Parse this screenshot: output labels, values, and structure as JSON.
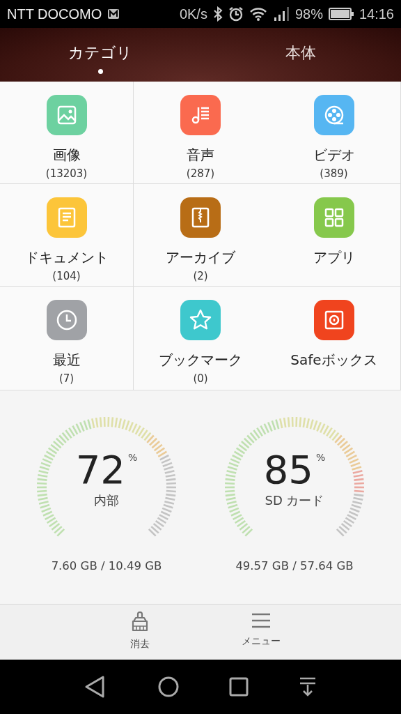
{
  "status_bar": {
    "carrier": "NTT DOCOMO",
    "speed": "0K/s",
    "battery": "98%",
    "time": "14:16"
  },
  "tabs": [
    {
      "label": "カテゴリ",
      "selected": true
    },
    {
      "label": "本体",
      "selected": false
    }
  ],
  "categories": [
    {
      "kind": "image",
      "label": "画像",
      "count": "(13203)",
      "color": "#6dd1a0"
    },
    {
      "kind": "audio",
      "label": "音声",
      "count": "(287)",
      "color": "#fa6a4f"
    },
    {
      "kind": "video",
      "label": "ビデオ",
      "count": "(389)",
      "color": "#56b6f2"
    },
    {
      "kind": "document",
      "label": "ドキュメント",
      "count": "(104)",
      "color": "#fcc53a"
    },
    {
      "kind": "archive",
      "label": "アーカイブ",
      "count": "(2)",
      "color": "#b86d16"
    },
    {
      "kind": "apps",
      "label": "アプリ",
      "color": "#86c84c"
    },
    {
      "kind": "recent",
      "label": "最近",
      "count": "(7)",
      "color": "#a0a2a6"
    },
    {
      "kind": "bookmark",
      "label": "ブックマーク",
      "count": "(0)",
      "color": "#3ec8cd"
    },
    {
      "kind": "safe",
      "label": "Safeボックス",
      "color": "#f0441e"
    }
  ],
  "storage": [
    {
      "percent": "72",
      "unit": "%",
      "name": "内部",
      "usage": "7.60 GB / 10.49 GB"
    },
    {
      "percent": "85",
      "unit": "%",
      "name": "SD カード",
      "usage": "49.57 GB / 57.64 GB"
    }
  ],
  "actions": [
    {
      "kind": "clean",
      "label": "消去"
    },
    {
      "kind": "menu",
      "label": "メニュー"
    }
  ]
}
